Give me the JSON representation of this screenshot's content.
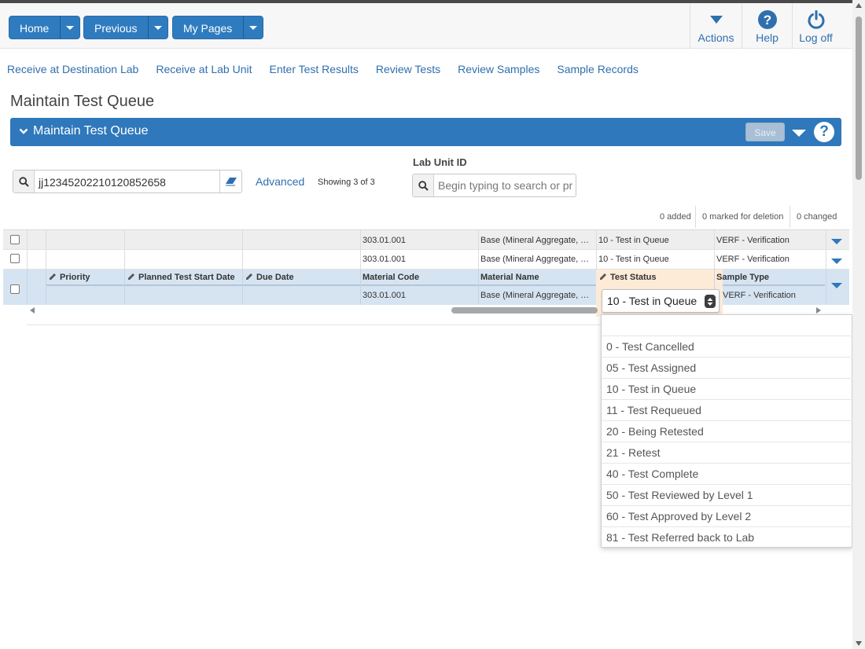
{
  "nav": {
    "home": "Home",
    "previous": "Previous",
    "my_pages": "My Pages",
    "actions": "Actions",
    "help": "Help",
    "log_off": "Log off"
  },
  "subnav": [
    "Receive at Destination Lab",
    "Receive at Lab Unit",
    "Enter Test Results",
    "Review Tests",
    "Review Samples",
    "Sample Records"
  ],
  "page_title": "Maintain Test Queue",
  "panel": {
    "title": "Maintain Test Queue",
    "save": "Save"
  },
  "search": {
    "value": "jj12345202210120852658",
    "advanced": "Advanced",
    "showing": "Showing 3 of 3"
  },
  "lab_unit": {
    "label": "Lab Unit ID",
    "placeholder": "Begin typing to search or pr"
  },
  "stats": {
    "added": "0 added",
    "deleted": "0 marked for deletion",
    "changed": "0 changed"
  },
  "columns": {
    "priority": "Priority",
    "planned_start": "Planned Test Start Date",
    "due_date": "Due Date",
    "material_code": "Material Code",
    "material_name": "Material Name",
    "test_status": "Test Status",
    "sample_type": "Sample Type"
  },
  "rows": [
    {
      "material_code": "303.01.001",
      "material_name": "Base (Mineral Aggregate, …",
      "test_status": "10 - Test in Queue",
      "sample_type": "VERF - Verification"
    },
    {
      "material_code": "303.01.001",
      "material_name": "Base (Mineral Aggregate, …",
      "test_status": "10 - Test in Queue",
      "sample_type": "VERF - Verification"
    },
    {
      "material_code": "303.01.001",
      "material_name": "Base (Mineral Aggregate, …",
      "test_status": "10 - Test in Queue",
      "sample_type": "VERF - Verification"
    }
  ],
  "status_options": [
    "",
    "0 - Test Cancelled",
    "05 - Test Assigned",
    "10 - Test in Queue",
    "11 - Test Requeued",
    "20 - Being Retested",
    "21 - Retest",
    "40 - Test Complete",
    "50 - Test Reviewed by Level 1",
    "60 - Test Approved by Level 2",
    "81 - Test Referred back to Lab"
  ],
  "colors": {
    "primary": "#2f7bbf",
    "link": "#2f6fae",
    "selected_row": "#d6e4f2",
    "editing_cell": "#fdebd8"
  }
}
